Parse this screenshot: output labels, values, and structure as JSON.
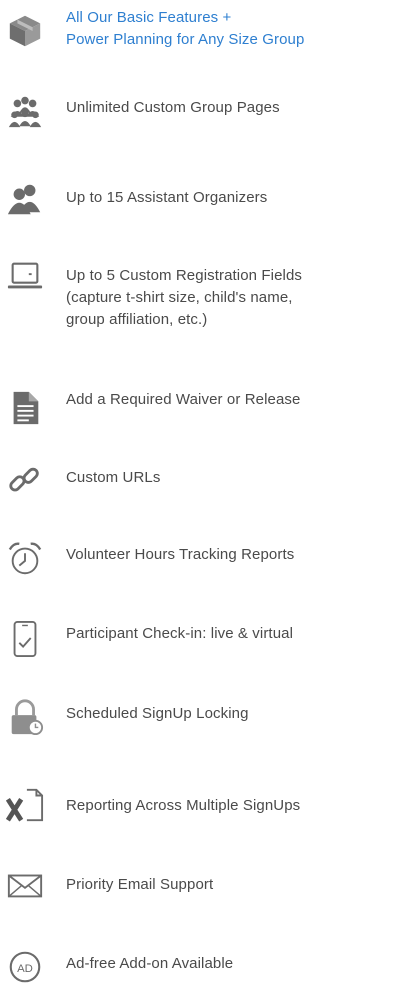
{
  "colors": {
    "accent": "#2e7fd0",
    "text": "#4a4a4a",
    "icon": "#6b6b6b"
  },
  "features": [
    {
      "icon": "cube-icon",
      "lines": [
        "All Our Basic Features +",
        "Power Planning for Any Size Group"
      ],
      "accent": true
    },
    {
      "icon": "group-icon",
      "lines": [
        "Unlimited Custom Group Pages"
      ]
    },
    {
      "icon": "two-people-icon",
      "lines": [
        "Up to 15 Assistant Organizers"
      ]
    },
    {
      "icon": "laptop-icon",
      "lines": [
        "Up to 5 Custom Registration Fields",
        "(capture t-shirt size, child's name,",
        "group affiliation, etc.)"
      ]
    },
    {
      "icon": "document-icon",
      "lines": [
        "Add a Required Waiver or Release"
      ]
    },
    {
      "icon": "link-icon",
      "lines": [
        "Custom URLs"
      ]
    },
    {
      "icon": "alarm-clock-icon",
      "lines": [
        "Volunteer Hours Tracking Reports"
      ]
    },
    {
      "icon": "phone-check-icon",
      "lines": [
        "Participant Check-in: live & virtual"
      ]
    },
    {
      "icon": "lock-clock-icon",
      "lines": [
        "Scheduled SignUp Locking"
      ]
    },
    {
      "icon": "excel-icon",
      "lines": [
        "Reporting Across Multiple SignUps"
      ]
    },
    {
      "icon": "envelope-icon",
      "lines": [
        "Priority Email Support"
      ]
    },
    {
      "icon": "ad-badge-icon",
      "lines": [
        "Ad-free Add-on Available"
      ],
      "icon_text": "AD"
    }
  ]
}
